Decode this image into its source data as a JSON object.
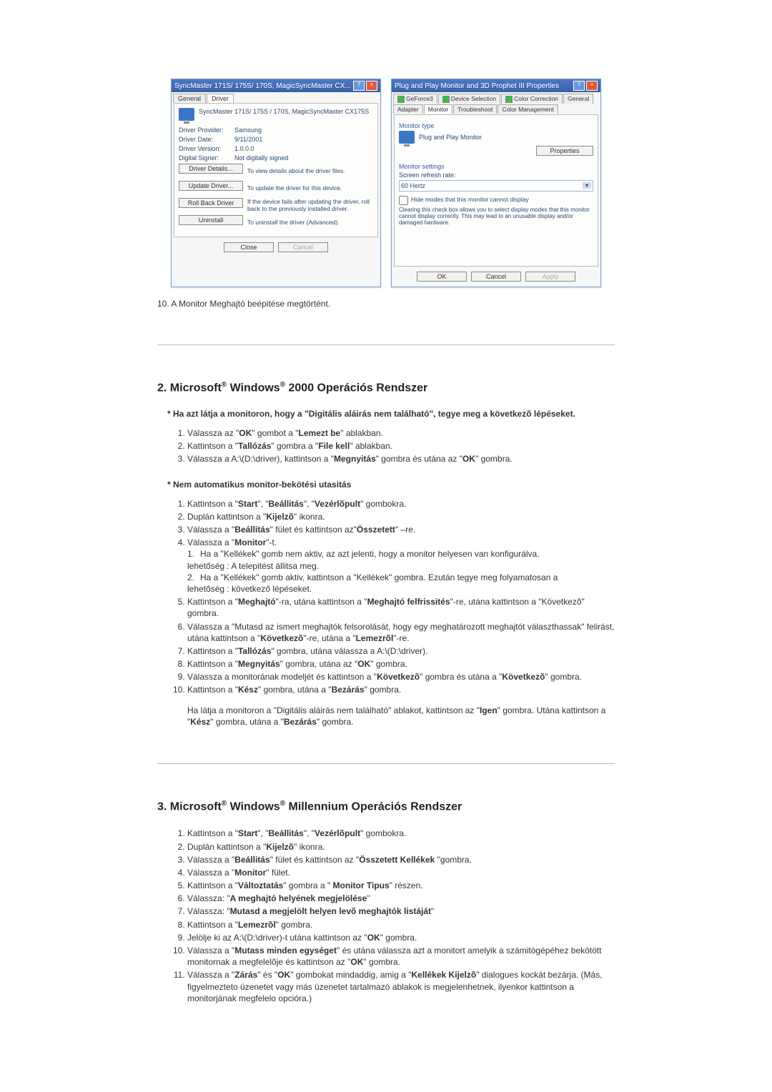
{
  "dialog1": {
    "title": "SyncMaster 171S/ 175S/ 170S, MagicSyncMaster CX...",
    "tabs": {
      "general": "General",
      "driver": "Driver"
    },
    "header": "SyncMaster 171S/ 175S / 170S, MagicSyncMaster CX175S",
    "rows": {
      "provider_label": "Driver Provider:",
      "provider_value": "Samsung",
      "date_label": "Driver Date:",
      "date_value": "9/11/2001",
      "version_label": "Driver Version:",
      "version_value": "1.0.0.0",
      "signer_label": "Digital Signer:",
      "signer_value": "Not digitally signed"
    },
    "btns": {
      "details": "Driver Details...",
      "details_desc": "To view details about the driver files.",
      "update": "Update Driver...",
      "update_desc": "To update the driver for this device.",
      "rollback": "Roll Back Driver",
      "rollback_desc": "If the device fails after updating the driver, roll back to the previously installed driver.",
      "uninstall": "Uninstall",
      "uninstall_desc": "To uninstall the driver (Advanced).",
      "close": "Close",
      "cancel": "Cancel"
    }
  },
  "dialog2": {
    "title": "Plug and Play Monitor and 3D Prophet III Properties",
    "tabs": {
      "geforce": "GeForce3",
      "device": "Device Selection",
      "color": "Color Correction",
      "general": "General",
      "adapter": "Adapter",
      "monitor": "Monitor",
      "trouble": "Troubleshoot",
      "colormgmt": "Color Management"
    },
    "section_monitor_type": "Monitor type",
    "monitor_name": "Plug and Play Monitor",
    "properties_btn": "Properties",
    "section_settings": "Monitor settings",
    "refresh_label": "Screen refresh rate:",
    "refresh_value": "60 Hertz",
    "hide_checkbox": "Hide modes that this monitor cannot display",
    "hide_hint": "Clearing this check box allows you to select display modes that this monitor cannot display correctly. This may lead to an unusable display and/or damaged hardware.",
    "ok": "OK",
    "cancel": "Cancel",
    "apply": "Apply"
  },
  "step10": "10.   A Monitor Meghajtó beépitése megtörtént.",
  "sec2": {
    "title_html": "2. Microsoft® Windows® 2000 Operációs Rendszer",
    "note1_html": "* Ha azt látja a monitoron, hogy a \"Digitális aláirás nem található\", tegye meg a következõ lépéseket.",
    "list1": [
      "Válassza az \"<b>OK</b>\" gombot a \"<b>Lemezt be</b>\" ablakban.",
      "Kattintson a \"<b>Tallózás</b>\" gombra a \"<b>File kell</b>\" ablakban.",
      "Válassza a A:\\(D:\\driver), kattintson a \"<b>Megnyitás</b>\" gombra és utána az \"<b>OK</b>\" gombra."
    ],
    "note2_html": "* Nem automatikus monitor-bekötési utasitás",
    "list2": [
      "Kattintson a \"<b>Start</b>\", \"<b>Beállitás</b>\", \"<b>Vezérlõpult</b>\" gombokra.",
      "Duplán kattintson a \"<b>Kijelzõ</b>\" ikonra.",
      "Válassza a \"<b>Beállitás</b>\" fület és kattintson az\"<b>Összetett</b>\" –re.",
      "Válassza a \"<b>Monitor</b>\"-t.<div class='subitem'><span class='num'>1.</span><span>Ha a \"Kellékek\" gomb nem aktiv, az azt jelenti, hogy a monitor helyesen van konfigurálva.</span></div><div>lehetőség : A telepitést állitsa meg.</div><div class='subitem'><span class='num'>2.</span><span>Ha a \"Kellékek\" gomb aktiv, kattintson a \"Kellékek\" gombra. Ezután tegye meg folyamatosan a</span></div><div>lehetőség : következő lépéseket.</div>",
      "Kattintson a \"<b>Meghajtó</b>\"-ra, utána kattintson a \"<b>Meghajtó felfrissités</b>\"-re, utána kattintson a \"Következõ\" gombra.",
      "Válassza a \"Mutasd az ismert meghajtók felsorolását, hogy egy meghatározott meghajtót választhassak\" felirást, utána kattintson a \"<b>Következõ</b>\"-re, utána a \"<b>Lemezrõl</b>\"-re.",
      "Kattintson a \"<b>Tallózás</b>\" gombra, utána válassza a A:\\(D:\\driver).",
      "Kattintson a \"<b>Megnyitás</b>\" gombra, utána az \"<b>OK</b>\" gombra.",
      "Válassza a monitorának modeljét és kattintson a \"<b>Következõ</b>\" gombra és utána a \"<b>Következõ</b>\" gombra.",
      "Kattintson a \"<b>Kész</b>\" gombra, utána a \"<b>Bezárás</b>\" gombra."
    ],
    "post_html": "Ha látja a monitoron a \"Digitális aláirás nem található\" ablakot, kattintson az \"<b>Igen</b>\" gombra. Utána kattintson a \"<b>Kész</b>\" gombra, utána a \"<b>Bezárás</b>\" gombra."
  },
  "sec3": {
    "title_html": "3. Microsoft® Windows® Millennium Operációs Rendszer",
    "list": [
      "Kattintson a \"<b>Start</b>\", \"<b>Beállitás</b>\", \"<b>Vezérlõpult</b>\" gombokra.",
      "Duplán kattintson a \"<b>Kijelzõ</b>\" ikonra.",
      "Válassza a \"<b>Beállitás</b>\" fület és kattintson az \"<b>Összetett Kellékek </b>\"gombra.",
      "Válassza a \"<b>Monitor</b>\" fület.",
      "Kattintson a \"<b>Változtatás</b>\" gombra a \" <b>Monitor Tipus</b>\" részen.",
      "Válassza: \"<b>A meghajtó helyének megjelölése</b>\"",
      "Válassza: \"<b>Mutasd a megjelölt helyen levõ meghajtók listáját</b>\"",
      "Kattintson a \"<b>Lemezrõl</b>\" gombra.",
      "Jelölje ki az A:\\(D:\\driver)-t utána kattintson az \"<b>OK</b>\" gombra.",
      "Válassza a \"<b>Mutass minden egységet</b>\" és utána válassza azt a monitort amelyik a számitógépéhez bekötött monitornak a megfelelõje és kattintson az \"<b>OK</b>\" gombra.",
      "Válassza a \"<b>Zárás</b>\" és \"<b>OK</b>\" gombokat mindaddig, amig a \"<b>Kellékek Kijelzõ</b>\" dialogues kockát bezárja. (Más, figyelmezteto üzenetet vagy más üzenetet tartalmazó ablakok is megjelenhetnek, ilyenkor kattintson a monitorjának megfelelo opcióra.)"
    ]
  }
}
